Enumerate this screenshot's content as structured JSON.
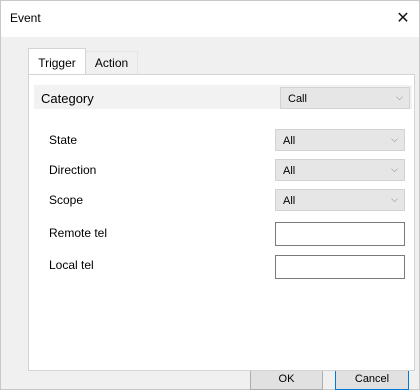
{
  "window": {
    "title": "Event",
    "close_glyph": "✕",
    "close_icon": "close-icon"
  },
  "tabs": [
    {
      "label": "Trigger",
      "selected": true
    },
    {
      "label": "Action",
      "selected": false
    }
  ],
  "trigger": {
    "category": {
      "label": "Category",
      "value": "Call"
    },
    "fields": {
      "state": {
        "label": "State",
        "value": "All"
      },
      "direction": {
        "label": "Direction",
        "value": "All"
      },
      "scope": {
        "label": "Scope",
        "value": "All"
      },
      "remote_tel": {
        "label": "Remote tel",
        "value": ""
      },
      "local_tel": {
        "label": "Local tel",
        "value": ""
      }
    },
    "chevron_glyph": "⌵"
  },
  "buttons": {
    "ok": "OK",
    "cancel": "Cancel"
  }
}
